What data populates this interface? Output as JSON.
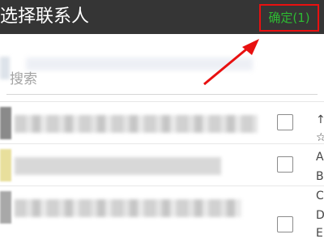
{
  "header": {
    "title": "选择联系人",
    "confirm_label": "确定(1)",
    "background": "#353535",
    "confirm_color": "#2dbb32",
    "highlight_color": "#e81010"
  },
  "search": {
    "placeholder": "搜索"
  },
  "index_bar": {
    "letters": [
      "↑",
      "☆",
      "A",
      "B",
      "C",
      "D",
      "E"
    ]
  },
  "contacts": [
    {
      "checked": false
    },
    {
      "checked": false
    },
    {
      "checked": false
    }
  ]
}
